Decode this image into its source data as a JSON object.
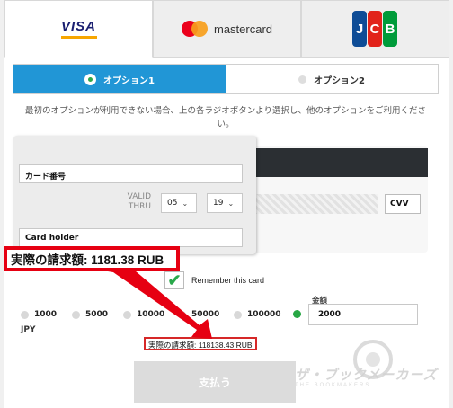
{
  "brand_tabs": [
    {
      "name": "VISA",
      "active": true
    },
    {
      "name": "mastercard",
      "active": false
    },
    {
      "name": "JCB",
      "active": false
    }
  ],
  "brand_colors": {
    "visa": "#1a1f71",
    "visa_accent": "#f7a600",
    "mastercard_red": "#eb001b",
    "mastercard_orange": "#f79e1b",
    "jcb_blue": "#0e4c96",
    "jcb_red": "#e2231a",
    "jcb_green": "#009b3a"
  },
  "options": {
    "option1_label": "オプション1",
    "option2_label": "オプション2",
    "selected": "option1",
    "accent_color": "#2196d6"
  },
  "notice": "最初のオプションが利用できない場合、上の各ラジオボタンより選択し、他のオプションをご利用ください。",
  "card_form": {
    "card_number_placeholder": "カード番号",
    "valid_thru_label": "VALID\nTHRU",
    "month": "05",
    "year": "19",
    "cardholder_placeholder": "Card holder",
    "cvv_placeholder": "CVV"
  },
  "remember_label": "Remember this card",
  "remember_checked": true,
  "amounts": {
    "options": [
      "1000",
      "5000",
      "10000",
      "50000",
      "100000",
      "2000"
    ],
    "selected": "2000",
    "currency": "JPY",
    "field_label": "金額",
    "field_value": "2000"
  },
  "small_total": "実際の請求額: 118138.43 RUB",
  "pay_button": "支払う",
  "annotation": {
    "callout_text": "実際の請求額: 1181.38 RUB",
    "color": "#e60012"
  },
  "watermark": {
    "text": "ザ・ブックメーカーズ",
    "sub": "THE BOOKMAKERS"
  }
}
